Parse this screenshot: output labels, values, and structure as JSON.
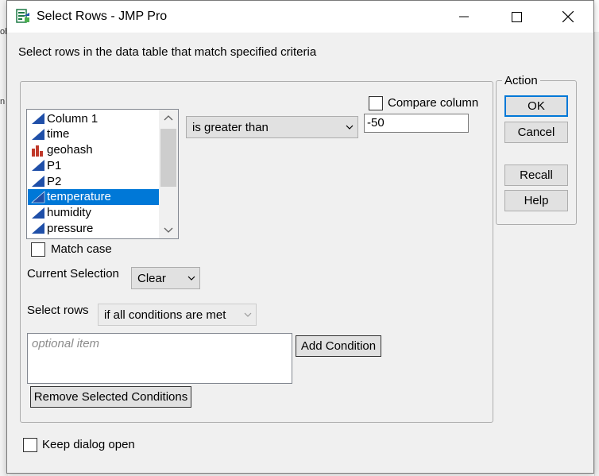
{
  "window": {
    "title": "Select Rows - JMP Pro",
    "instructions": "Select rows in the data table that match specified criteria"
  },
  "colors": {
    "accent": "#0078d7",
    "continuous_icon": "#1f4fa8",
    "nominal_icon": "#c0392b"
  },
  "columns": [
    {
      "label": "Column 1",
      "icon": "continuous-icon",
      "selected": false
    },
    {
      "label": "time",
      "icon": "continuous-icon",
      "selected": false
    },
    {
      "label": "geohash",
      "icon": "nominal-icon",
      "selected": false
    },
    {
      "label": "P1",
      "icon": "continuous-icon",
      "selected": false
    },
    {
      "label": "P2",
      "icon": "continuous-icon",
      "selected": false
    },
    {
      "label": "temperature",
      "icon": "continuous-icon",
      "selected": true
    },
    {
      "label": "humidity",
      "icon": "continuous-icon",
      "selected": false
    },
    {
      "label": "pressure",
      "icon": "continuous-icon",
      "selected": false
    }
  ],
  "condition": {
    "operator": "is greater than",
    "value": "-50",
    "compare_column_label": "Compare column",
    "compare_column_checked": false
  },
  "match_case": {
    "label": "Match case",
    "checked": false
  },
  "current_selection": {
    "label": "Current Selection",
    "value": "Clear"
  },
  "select_rows": {
    "label": "Select rows",
    "value": "if all conditions are met"
  },
  "conditions_list": {
    "placeholder": "optional item"
  },
  "buttons": {
    "add_condition": "Add Condition",
    "remove_selected": "Remove Selected Conditions"
  },
  "action": {
    "legend": "Action",
    "ok": "OK",
    "cancel": "Cancel",
    "recall": "Recall",
    "help": "Help"
  },
  "keep_open": {
    "label": "Keep dialog open",
    "checked": false
  }
}
